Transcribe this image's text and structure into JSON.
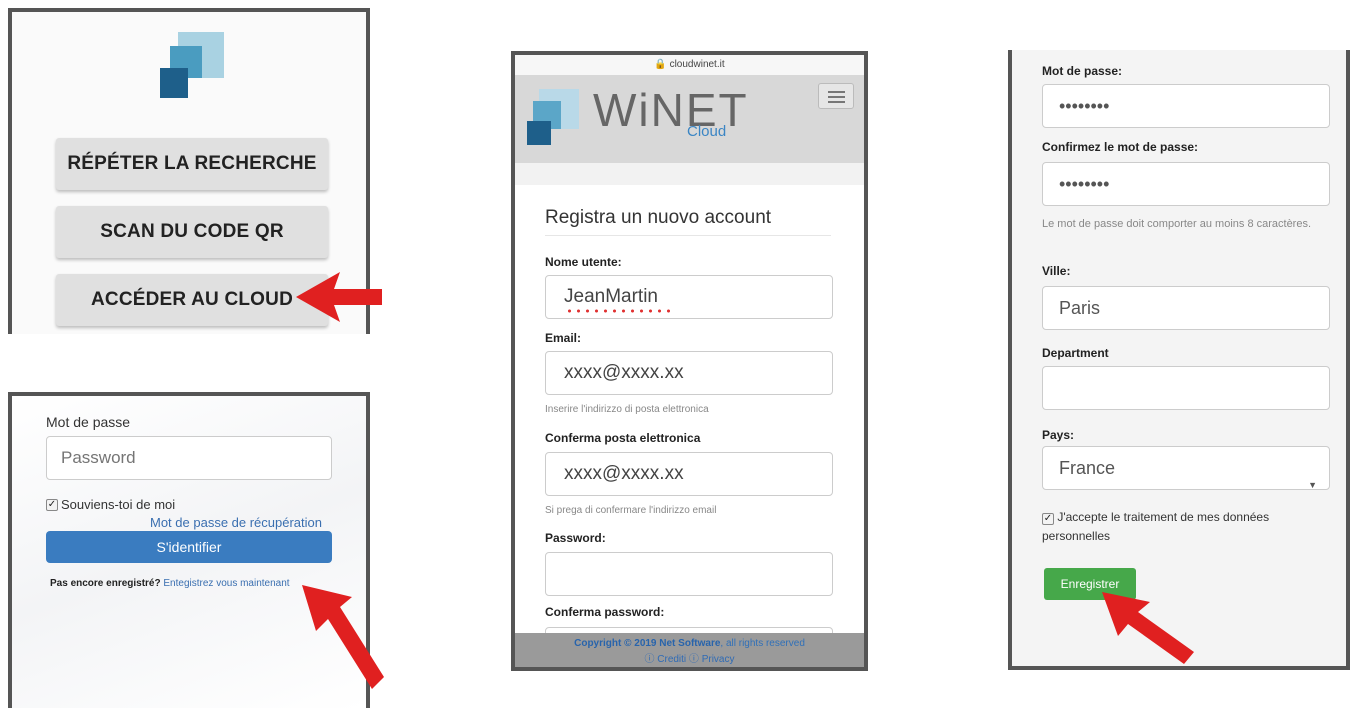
{
  "app_panel": {
    "buttons": [
      "RÉPÉTER LA RECHERCHE",
      "SCAN DU CODE QR",
      "ACCÉDER AU CLOUD"
    ]
  },
  "login_panel": {
    "password_label": "Mot de passe",
    "password_placeholder": "Password",
    "remember_check": "✓",
    "remember_label": "Souviens-toi de moi",
    "forgot_link": "Mot de passe de récupération",
    "login_button": "S'identifier",
    "not_registered": "Pas encore enregistré?",
    "register_link": "Entegistrez vous maintenant"
  },
  "mobile_panel": {
    "url": "🔒 cloudwinet.it",
    "brand": "WiNET",
    "brand_sub": "Cloud",
    "title": "Registra un nuovo account",
    "username_label": "Nome utente:",
    "username_value": "JeanMartin",
    "email_label": "Email:",
    "email_value": "xxxx@xxxx.xx",
    "email_help": "Inserire l'indirizzo di posta elettronica",
    "confirm_email_label": "Conferma posta elettronica",
    "confirm_email_value": "xxxx@xxxx.xx",
    "confirm_email_help": "Si prega di confermare l'indirizzo email",
    "password_label": "Password:",
    "confirm_password_label": "Conferma password:",
    "footer_copyright": "Copyright © 2019 Net Software",
    "footer_rights": ", all rights reserved",
    "footer_links": "ⓘ Crediti   ⓘ Privacy"
  },
  "register_panel": {
    "password_label": "Mot de passe:",
    "password_value": "••••••••",
    "confirm_label": "Confirmez le mot de passe:",
    "confirm_value": "••••••••",
    "password_help": "Le mot de passe doit comporter au moins 8 caractères.",
    "city_label": "Ville:",
    "city_value": "Paris",
    "department_label": "Department",
    "department_value": "",
    "country_label": "Pays:",
    "country_value": "France",
    "consent_check": "✓",
    "consent_label": "J'accepte le traitement de mes données personnelles",
    "submit_button": "Enregistrer"
  },
  "colors": {
    "arrow": "#e02020",
    "login_button": "#3a7cc0",
    "submit_button": "#46a84a",
    "link": "#3a6fb0"
  }
}
